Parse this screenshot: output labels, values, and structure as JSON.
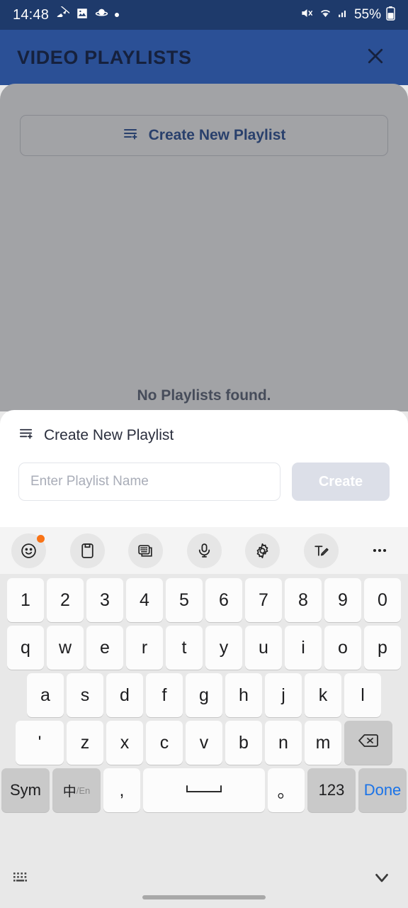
{
  "statusbar": {
    "time": "14:48",
    "battery_percent": "55%",
    "icons_left": [
      "muted-notification-icon",
      "image-icon",
      "planet-icon",
      "dot-icon"
    ],
    "icons_right": [
      "volume-muted-icon",
      "wifi-icon",
      "signal-icon",
      "battery-icon"
    ]
  },
  "header": {
    "title": "VIDEO PLAYLISTS",
    "close_icon": "close-icon",
    "bg_color": "#2b5096",
    "title_color": "#16213d"
  },
  "page": {
    "create_button_label": "Create New Playlist",
    "create_button_icon": "playlist-add-icon",
    "empty_message": "No Playlists found.",
    "accent_color": "#2b5096"
  },
  "sheet": {
    "heading": "Create New Playlist",
    "heading_icon": "playlist-add-icon",
    "input_value": "",
    "input_placeholder": "Enter Playlist Name",
    "create_label": "Create",
    "create_disabled_bg": "#dcdfe8"
  },
  "keyboard": {
    "toolbar": [
      {
        "name": "emoji-icon",
        "badge": true
      },
      {
        "name": "clipboard-icon",
        "badge": false
      },
      {
        "name": "keyboard-layers-icon",
        "badge": false
      },
      {
        "name": "microphone-icon",
        "badge": false
      },
      {
        "name": "settings-gear-icon",
        "badge": false
      },
      {
        "name": "handwriting-icon",
        "badge": false
      },
      {
        "name": "more-options-icon",
        "badge": false
      }
    ],
    "badge_color": "#f97316",
    "row_numbers": [
      "1",
      "2",
      "3",
      "4",
      "5",
      "6",
      "7",
      "8",
      "9",
      "0"
    ],
    "row_top": [
      "q",
      "w",
      "e",
      "r",
      "t",
      "y",
      "u",
      "i",
      "o",
      "p"
    ],
    "row_home": [
      "a",
      "s",
      "d",
      "f",
      "g",
      "h",
      "j",
      "k",
      "l"
    ],
    "row_bottom": [
      "'",
      "z",
      "x",
      "c",
      "v",
      "b",
      "n",
      "m"
    ],
    "backspace_icon": "backspace-icon",
    "fn_sym": "Sym",
    "fn_lang_cn": "中",
    "fn_lang_en": "/En",
    "fn_comma": ",",
    "fn_space_icon": "space-icon",
    "fn_period": "。",
    "fn_123": "123",
    "fn_done": "Done",
    "done_color": "#1a73e8",
    "bottom_left_icon": "keyboard-icon",
    "bottom_right_icon": "chevron-down-icon"
  }
}
